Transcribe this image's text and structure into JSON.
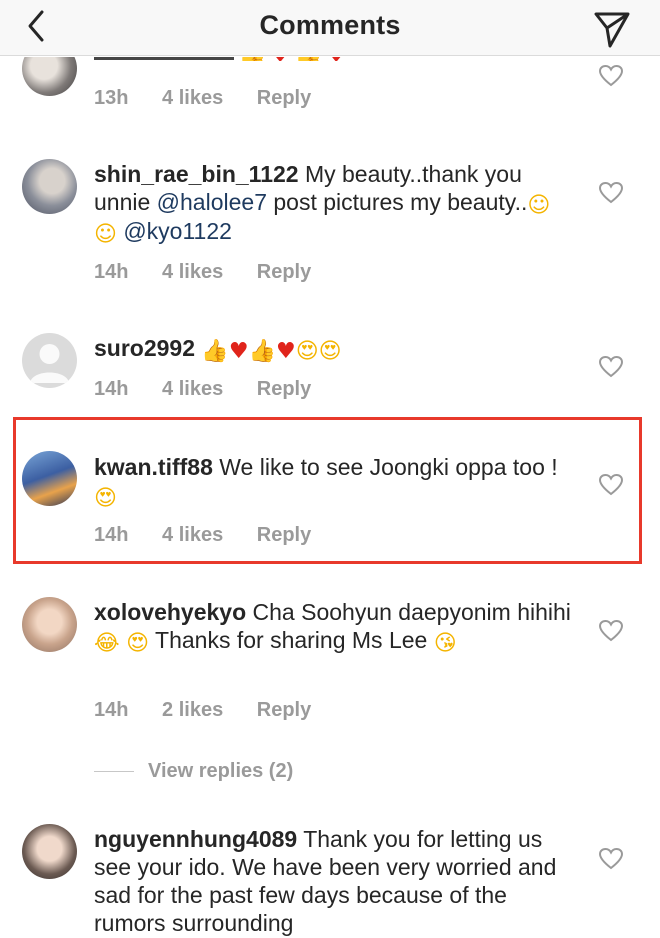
{
  "header": {
    "title": "Comments"
  },
  "comments": [
    {
      "time": "13h",
      "likes": "4 likes",
      "reply": "Reply"
    },
    {
      "username": "shin_rae_bin_1122",
      "text_a": "My beauty..thank you unnie ",
      "mention_1": "@halolee7",
      "text_b": " post pictures my beauty..",
      "mention_2": "@kyo1122",
      "time": "14h",
      "likes": "4 likes",
      "reply": "Reply"
    },
    {
      "username": "suro2992",
      "time": "14h",
      "likes": "4 likes",
      "reply": "Reply"
    },
    {
      "username": "kwan.tiff88",
      "text_a": "We like to see Joongki oppa too ! ",
      "time": "14h",
      "likes": "4 likes",
      "reply": "Reply"
    },
    {
      "username": "xolovehyekyo",
      "text_a": "Cha Soohyun daepyonim hihihi ",
      "text_b": " Thanks for sharing Ms Lee",
      "time": "14h",
      "likes": "2 likes",
      "reply": "Reply"
    },
    {
      "username": "nguyennhung4089",
      "text_a": "Thank you for letting us see your ido. We have been very worried and sad for the past few days because of the rumors surrounding"
    }
  ],
  "view_replies": "View replies (2)",
  "icons": {
    "back": "chevron-left-icon",
    "send": "paper-plane-icon",
    "like": "heart-outline-icon"
  },
  "colors": {
    "highlight": "#e8392b",
    "meta": "#9a9a9a",
    "mention": "#1e3a5f"
  }
}
